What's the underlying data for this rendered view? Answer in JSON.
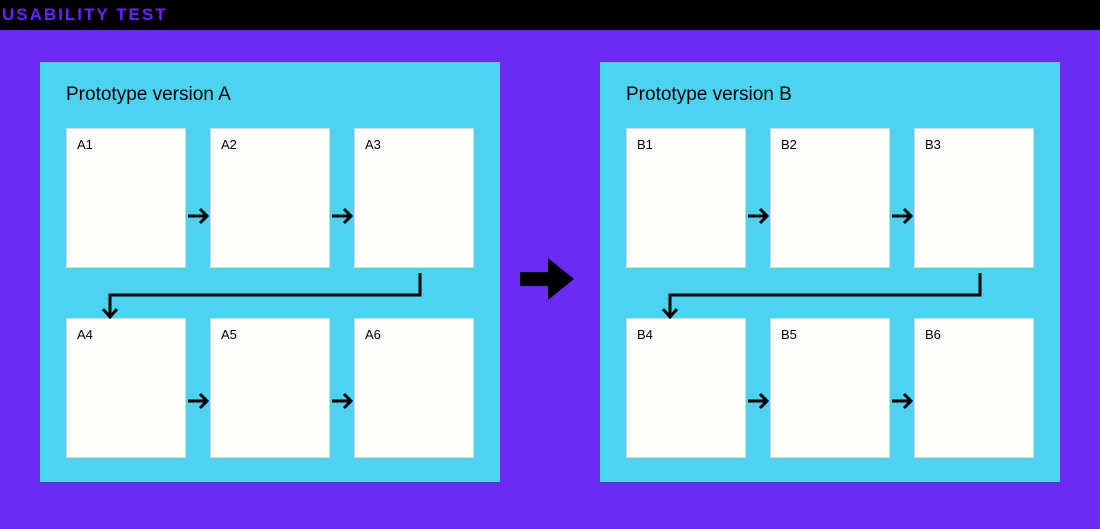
{
  "header": {
    "title": "USABILITY TEST"
  },
  "panelA": {
    "title": "Prototype version A",
    "screens": [
      "A1",
      "A2",
      "A3",
      "A4",
      "A5",
      "A6"
    ]
  },
  "panelB": {
    "title": "Prototype version B",
    "screens": [
      "B1",
      "B2",
      "B3",
      "B4",
      "B5",
      "B6"
    ]
  }
}
